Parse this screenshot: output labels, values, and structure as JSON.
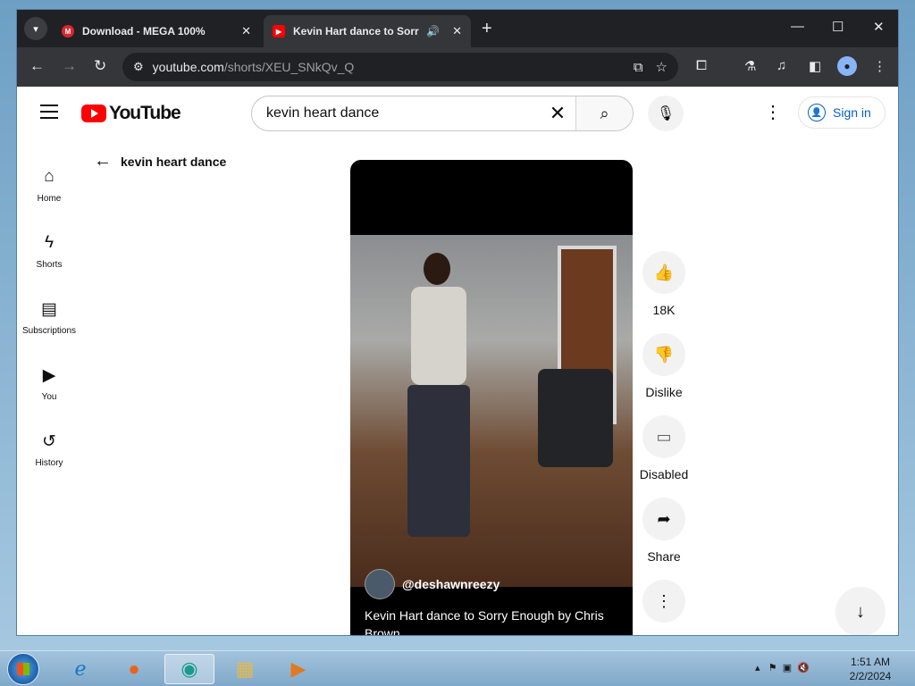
{
  "browser": {
    "tabs": [
      {
        "label": "Download - MEGA 100%",
        "favicon": "mega-icon"
      },
      {
        "label": "Kevin Hart dance to Sorry Enough by Chris Brown",
        "favicon": "youtube-icon",
        "audio": true
      }
    ],
    "url_host": "youtube.com",
    "url_path": "/shorts/XEU_SNkQv_Q"
  },
  "youtube": {
    "logo_text": "YouTube",
    "search_value": "kevin heart dance",
    "signin_label": "Sign in",
    "guide": [
      {
        "label": "Home",
        "icon": "home-icon"
      },
      {
        "label": "Shorts",
        "icon": "shorts-icon"
      },
      {
        "label": "Subscriptions",
        "icon": "subscriptions-icon"
      },
      {
        "label": "You",
        "icon": "you-icon"
      },
      {
        "label": "History",
        "icon": "history-icon"
      }
    ],
    "back_label": "kevin heart dance",
    "short": {
      "channel": "@deshawnreezy",
      "title": "Kevin Hart dance to Sorry Enough by Chris Brown"
    },
    "actions": {
      "like": "18K",
      "dislike": "Dislike",
      "comments": "Disabled",
      "share": "Share"
    }
  },
  "taskbar": {
    "time": "1:51 AM",
    "date": "2/2/2024"
  },
  "colors": {
    "accent": "#065fd4",
    "brand": "#ff0000",
    "chrome_dark": "#202124"
  }
}
